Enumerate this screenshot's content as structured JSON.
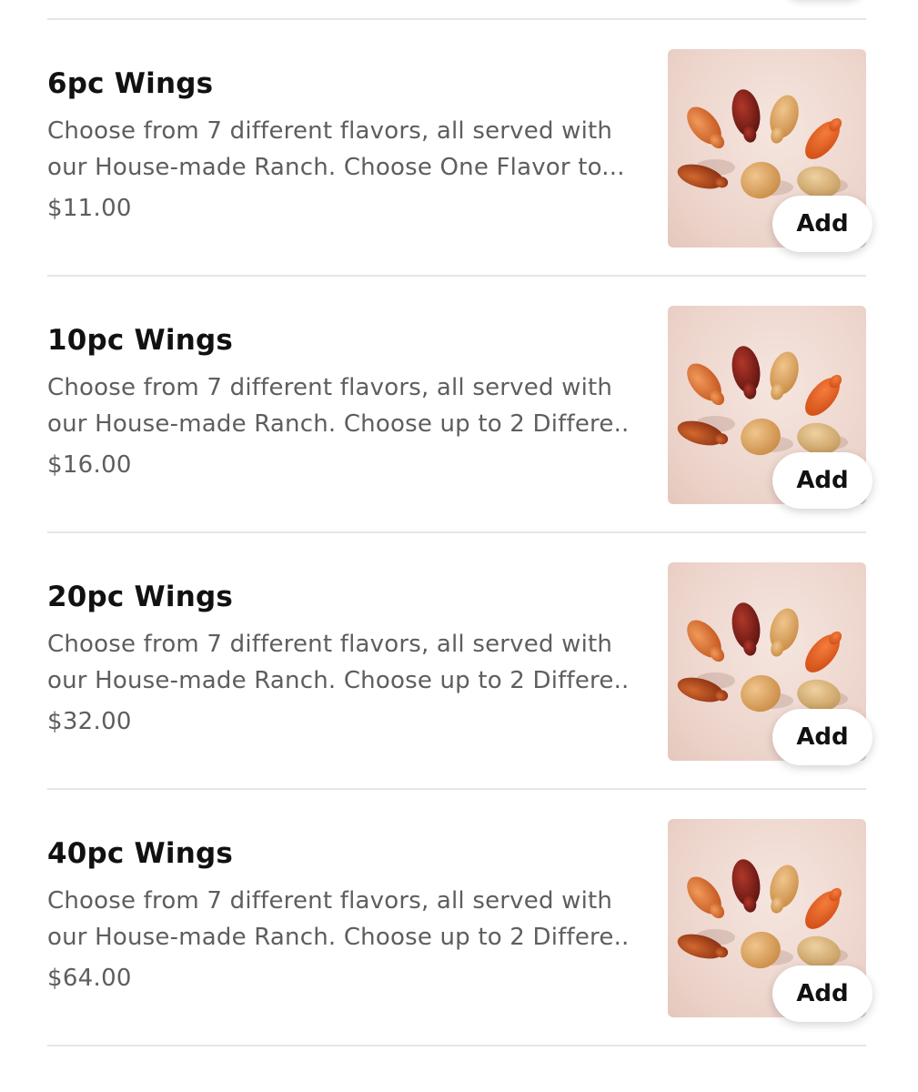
{
  "menu": {
    "items": [
      {
        "name": "6pc Wings",
        "description_line1": "Choose from 7 different flavors, all served with",
        "description_line2": "our House-made Ranch. Choose One Flavor to...",
        "price": "$11.00",
        "image_icon": "chicken-wings-image",
        "add_label": "Add"
      },
      {
        "name": "10pc Wings",
        "description_line1": "Choose from 7 different flavors, all served with",
        "description_line2": "our House-made Ranch. Choose up to 2 Differe...",
        "price": "$16.00",
        "image_icon": "chicken-wings-image",
        "add_label": "Add"
      },
      {
        "name": "20pc Wings",
        "description_line1": "Choose from 7 different flavors, all served with",
        "description_line2": "our House-made Ranch. Choose up to 2 Differe...",
        "price": "$32.00",
        "image_icon": "chicken-wings-image",
        "add_label": "Add"
      },
      {
        "name": "40pc Wings",
        "description_line1": "Choose from 7 different flavors, all served with",
        "description_line2": "our House-made Ranch. Choose up to 2 Differe...",
        "price": "$64.00",
        "image_icon": "chicken-wings-image",
        "add_label": "Add"
      }
    ]
  },
  "colors": {
    "background": "#ffffff",
    "title_text": "#111111",
    "body_text": "#5e5e5e",
    "divider": "#e6e6e6",
    "image_background": "#ecd3ca"
  }
}
